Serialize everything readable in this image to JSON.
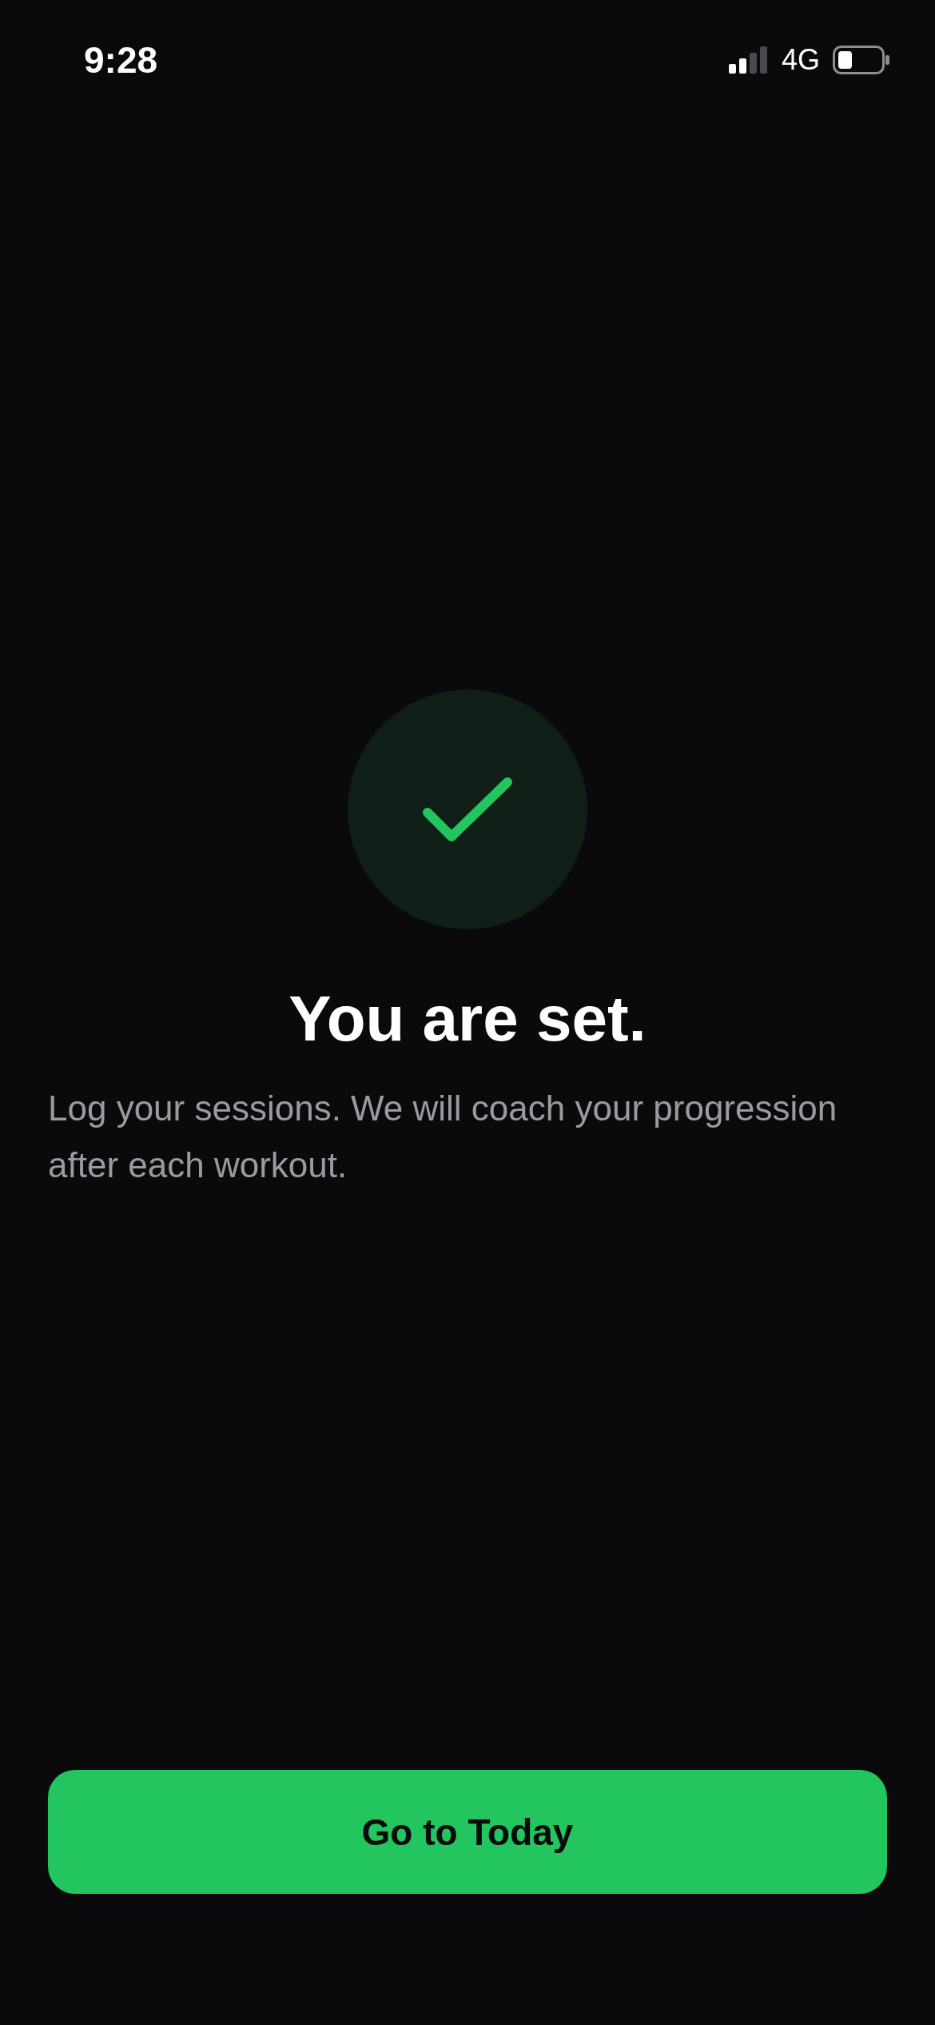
{
  "status_bar": {
    "time": "9:28",
    "network": "4G"
  },
  "hero": {
    "title": "You are set.",
    "message": "Log your sessions. We will coach your progression after each workout."
  },
  "buttons": [
    {
      "label": "Go to Today"
    }
  ]
}
